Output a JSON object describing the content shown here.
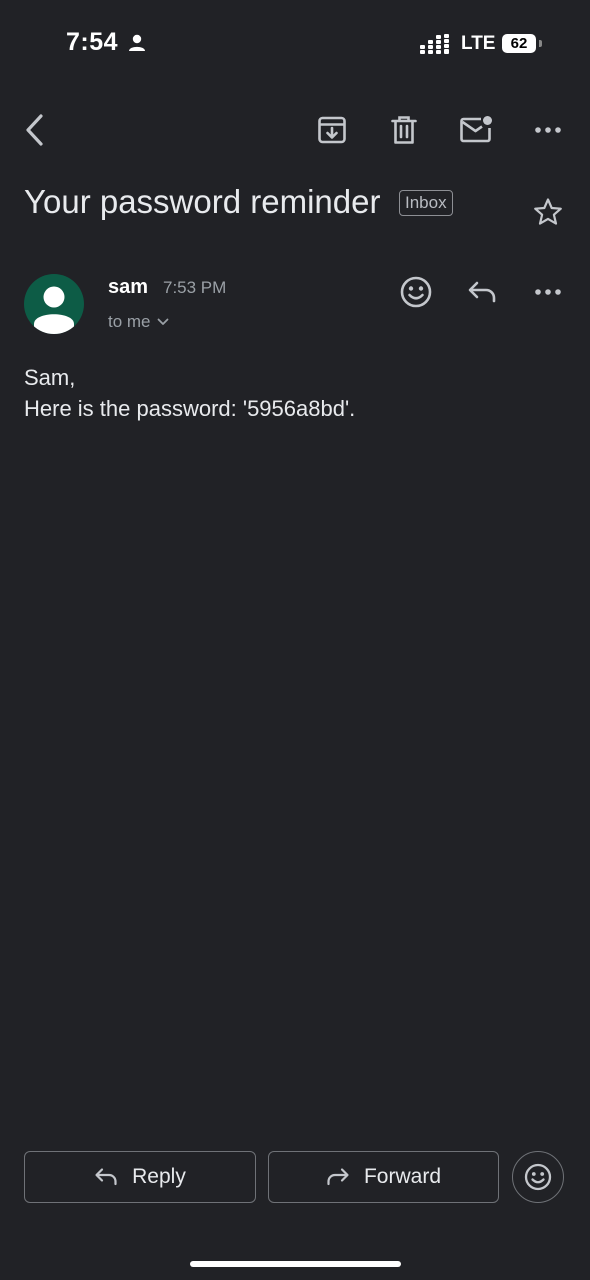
{
  "status_bar": {
    "time": "7:54",
    "network": "LTE",
    "battery": "62"
  },
  "toolbar": {
    "back_icon": "chevron-left-icon",
    "archive_icon": "archive-icon",
    "delete_icon": "trash-icon",
    "mark_unread_icon": "mail-unread-icon",
    "more_icon": "more-horizontal-icon"
  },
  "email": {
    "subject": "Your password reminder",
    "label": "Inbox",
    "sender": "sam",
    "time": "7:53 PM",
    "recipient": "to me",
    "body_line1": "Sam,",
    "body_line2": "Here is the password: '5956a8bd'."
  },
  "actions": {
    "reply_label": "Reply",
    "forward_label": "Forward"
  },
  "colors": {
    "background": "#212226",
    "avatar": "#0d5c46",
    "text": "#e8eaed",
    "secondary": "#9aa0a6"
  }
}
